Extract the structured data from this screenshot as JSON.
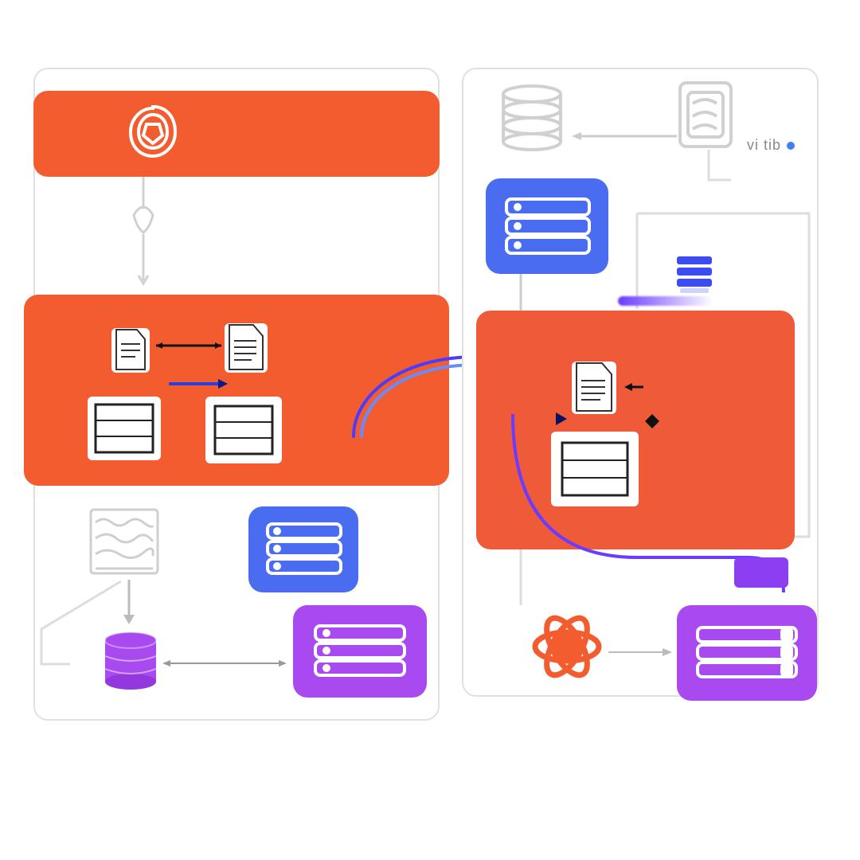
{
  "colors": {
    "orange": "#f25c2e",
    "orange_soft": "#ef5b39",
    "blue": "#4a6cf0",
    "purple": "#a84af0",
    "purple_dark": "#8b3ff0",
    "stroke_light": "#e0e0e0",
    "white": "#ffffff",
    "text_gray": "#888888",
    "accent_blue": "#3b82f6"
  },
  "labels": {
    "corner_tag": "vi tib"
  },
  "icons": {
    "left_header": "swirl-logo-icon",
    "left_doc_a": "document-icon",
    "left_doc_b": "document-icon",
    "left_grid_a": "table-icon",
    "left_grid_b": "table-icon",
    "left_shelf": "shelf-icon",
    "left_server_blue": "server-rack-icon",
    "left_database": "database-icon",
    "left_server_purple": "server-rack-icon",
    "right_disks": "disk-stack-icon",
    "right_module": "module-icon",
    "right_server_blue": "server-rack-icon",
    "right_server_small": "server-stack-icon",
    "right_doc": "document-icon",
    "right_grid": "table-icon",
    "right_atom": "atom-icon",
    "right_server_purple": "server-rack-icon"
  },
  "diagram": {
    "left_panel_nodes": [
      "header-logo",
      "process-block",
      "doc-a",
      "doc-b",
      "grid-a",
      "grid-b",
      "shelf",
      "server-blue",
      "database-purple",
      "server-purple"
    ],
    "right_panel_nodes": [
      "disk-stack",
      "module-box",
      "server-blue",
      "server-small",
      "process-block",
      "doc",
      "grid",
      "atom",
      "server-purple",
      "purple-chip"
    ],
    "connections": [
      {
        "from": "header-logo",
        "to": "process-block",
        "style": "line"
      },
      {
        "from": "doc-a",
        "to": "doc-b",
        "style": "bidir-arrow"
      },
      {
        "from": "doc-b",
        "to": "grid-b",
        "style": "arrow-blue"
      },
      {
        "from": "process-block",
        "to": "right.process-block",
        "style": "curved-blue"
      },
      {
        "from": "shelf",
        "to": "database-purple",
        "style": "arrow"
      },
      {
        "from": "database-purple",
        "to": "server-purple",
        "style": "bidir-arrow"
      },
      {
        "from": "right.disk-stack",
        "to": "right.module-box",
        "style": "arrow"
      },
      {
        "from": "right.server-blue",
        "to": "right.process-block",
        "style": "line"
      },
      {
        "from": "right.atom",
        "to": "right.server-purple",
        "style": "arrow"
      },
      {
        "from": "right.process-block",
        "to": "right.purple-chip",
        "style": "curved-purple"
      }
    ]
  }
}
